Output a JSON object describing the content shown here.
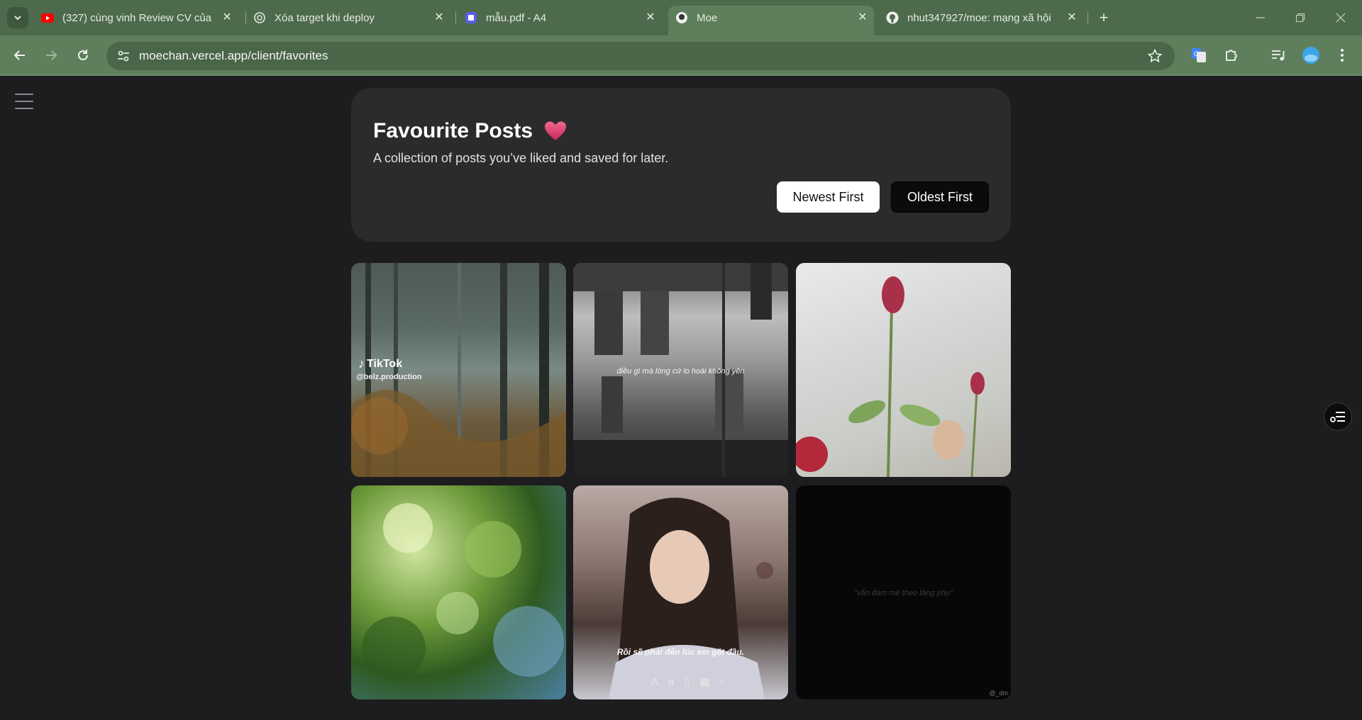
{
  "browser": {
    "tabs": [
      {
        "title": "(327) cùng vinh Review CV của",
        "icon": "youtube-icon",
        "active": false
      },
      {
        "title": "Xóa target khi deploy",
        "icon": "chatgpt-icon",
        "active": false
      },
      {
        "title": "mẫu.pdf - A4",
        "icon": "pdf-editor-icon",
        "active": false
      },
      {
        "title": "Moe",
        "icon": "moe-icon",
        "active": true
      },
      {
        "title": "nhut347927/moe: mạng xã hội",
        "icon": "github-icon",
        "active": false
      }
    ],
    "url": "moechan.vercel.app/client/favorites",
    "colors": {
      "frame": "#4e6a4c",
      "toolbar": "#5f7e5c",
      "omnibox": "#4a6548"
    }
  },
  "page": {
    "title": "Favourite Posts",
    "title_emoji": "heart-icon",
    "subtitle": "A collection of posts you’ve liked and saved for later.",
    "sort": {
      "newest": "Newest First",
      "oldest": "Oldest First",
      "selected": "newest"
    },
    "posts": [
      {
        "overlay_brand": "TikTok",
        "overlay_handle": "@belz.production"
      },
      {
        "caption": "điều gì mà lòng cứ lo hoài không yên"
      },
      {
        "caption": ""
      },
      {
        "caption": ""
      },
      {
        "caption": "Rồi sẽ phải đến lúc em gặt đầu."
      },
      {
        "caption": "\"vẫn đam mê theo tăng phụ\"",
        "handle": "@_dm"
      }
    ]
  }
}
